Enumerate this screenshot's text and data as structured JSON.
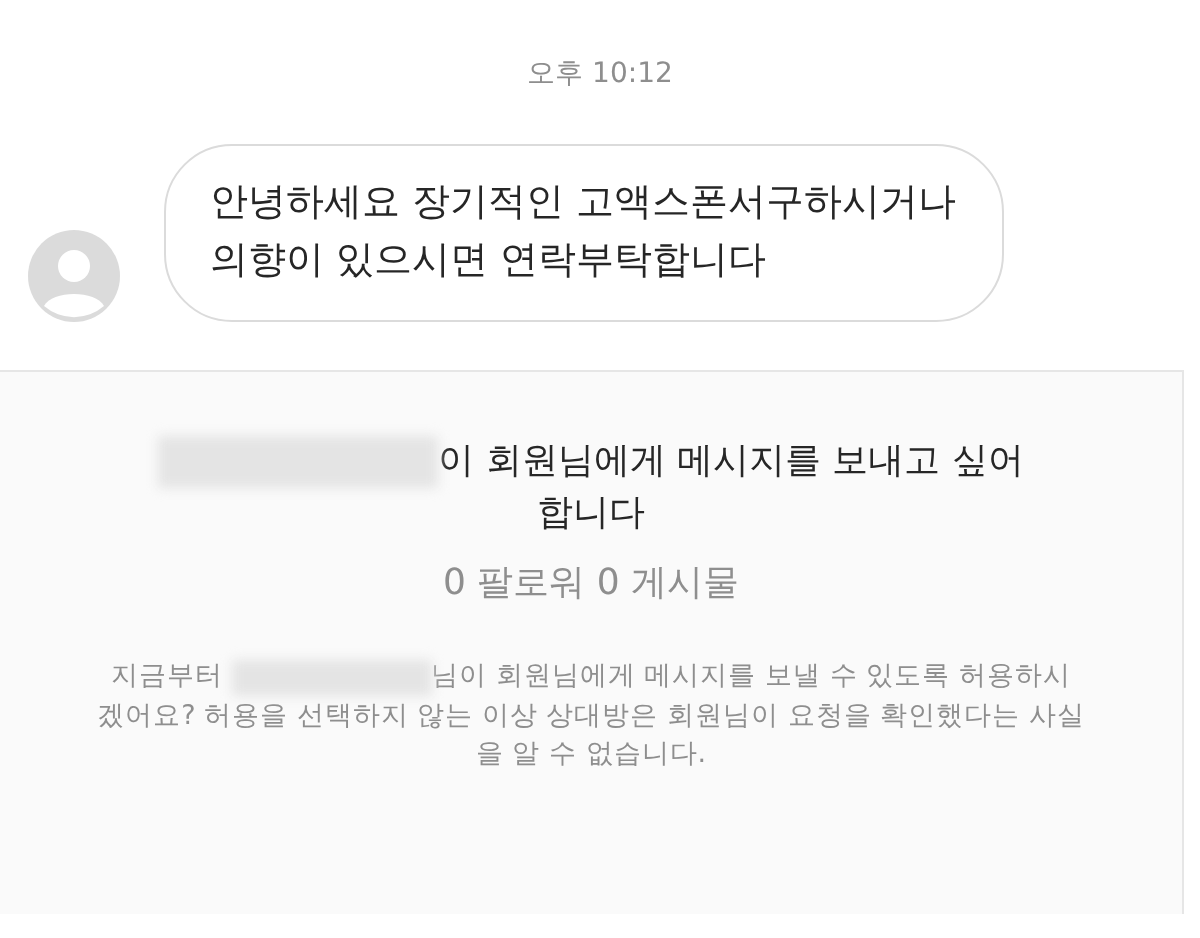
{
  "timestamp": "오후 10:12",
  "message": {
    "text": "안녕하세요 장기적인 고액스폰서구하시거나 의향이 있으시면 연락부탁합니다"
  },
  "request": {
    "heading": "이 회원님에게 메시지를 보내고 싶어 합니다",
    "stats": "0 팔로워 0 게시물",
    "notice_start": "지금부터",
    "notice_line_1": "님이 회원님에게 메시지를 보낼 수 있도록 허용하시",
    "notice_rest": "겠어요? 허용을 선택하지 않는 이상 상대방은 회원님이 요청을 확인했다는 사실을 알 수 없습니다."
  }
}
